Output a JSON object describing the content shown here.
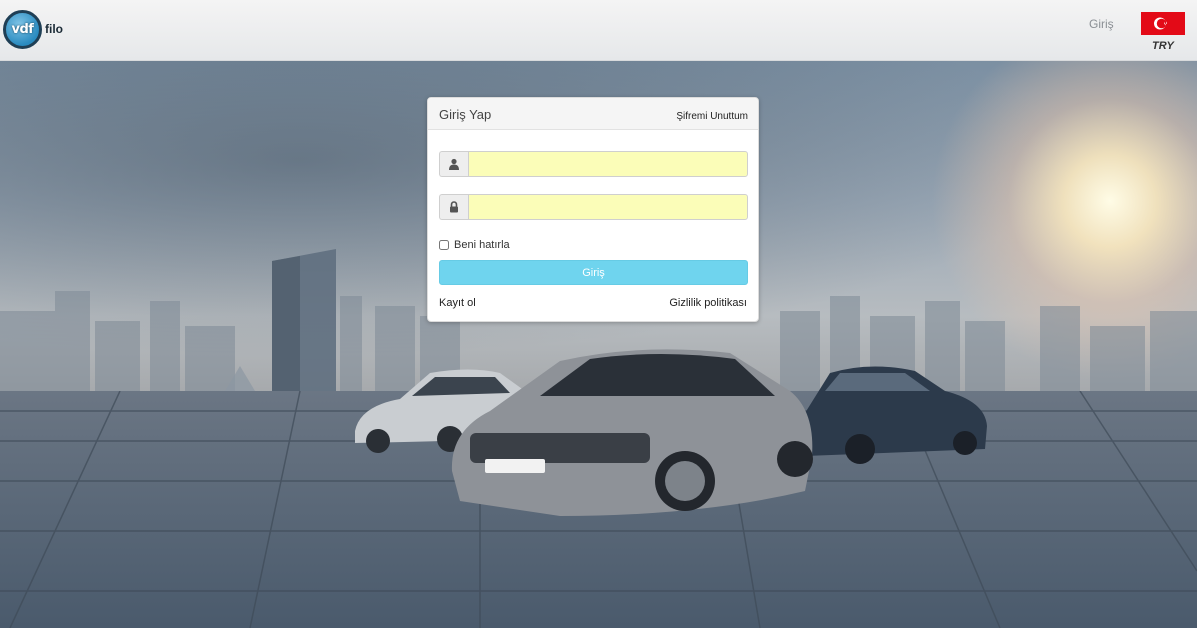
{
  "header": {
    "logo_mark": "vdf",
    "logo_text": "filo",
    "login_link": "Giriş",
    "currency": "TRY"
  },
  "login_card": {
    "title": "Giriş Yap",
    "forgot_password": "Şifremi Unuttum",
    "username_value": "",
    "password_value": "",
    "remember_me_label": "Beni hatırla",
    "remember_me_checked": false,
    "submit_label": "Giriş",
    "register_link": "Kayıt ol",
    "privacy_link": "Gizlilik politikası"
  },
  "icons": {
    "username": "user-icon",
    "password": "lock-icon",
    "flag": "turkey-flag-icon"
  },
  "colors": {
    "submit_button": "#6fd4ee",
    "input_autofill": "#fbfdb8",
    "flag_red": "#e30a17"
  }
}
